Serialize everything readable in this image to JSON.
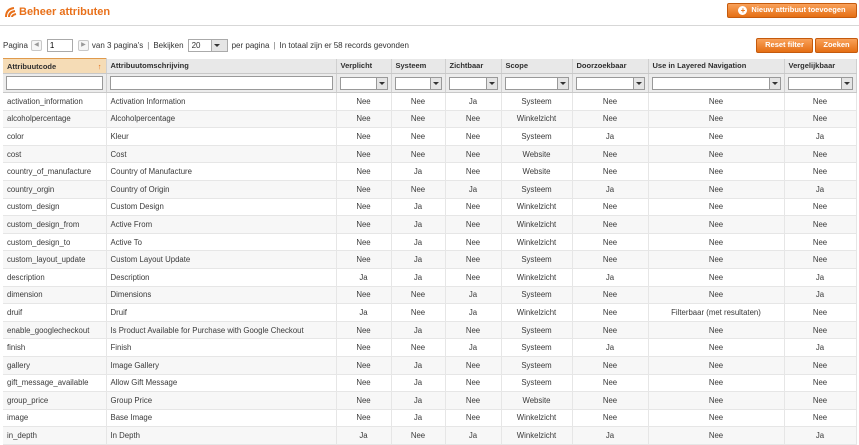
{
  "header": {
    "title": "Beheer attributen",
    "new_button": "Nieuw attribuut toevoegen"
  },
  "pager": {
    "page_label": "Pagina",
    "page_value": "1",
    "of_pages": "van 3 pagina's",
    "view_label": "Bekijken",
    "per_page_value": "20",
    "per_page_label": "per pagina",
    "total_text": "In totaal zijn er 58 records gevonden"
  },
  "buttons": {
    "reset": "Reset filter",
    "search": "Zoeken"
  },
  "columns": [
    "Attribuutcode",
    "Attribuutomschrijving",
    "Verplicht",
    "Systeem",
    "Zichtbaar",
    "Scope",
    "Doorzoekbaar",
    "Use in Layered Navigation",
    "Vergelijkbaar"
  ],
  "sort_indicator": "↑",
  "rows": [
    [
      "activation_information",
      "Activation Information",
      "Nee",
      "Nee",
      "Ja",
      "Systeem",
      "Nee",
      "Nee",
      "Nee"
    ],
    [
      "alcoholpercentage",
      "Alcoholpercentage",
      "Nee",
      "Nee",
      "Nee",
      "Winkelzicht",
      "Nee",
      "Nee",
      "Nee"
    ],
    [
      "color",
      "Kleur",
      "Nee",
      "Nee",
      "Nee",
      "Systeem",
      "Ja",
      "Nee",
      "Ja"
    ],
    [
      "cost",
      "Cost",
      "Nee",
      "Nee",
      "Nee",
      "Website",
      "Nee",
      "Nee",
      "Nee"
    ],
    [
      "country_of_manufacture",
      "Country of Manufacture",
      "Nee",
      "Ja",
      "Nee",
      "Website",
      "Nee",
      "Nee",
      "Nee"
    ],
    [
      "country_orgin",
      "Country of Origin",
      "Nee",
      "Nee",
      "Ja",
      "Systeem",
      "Ja",
      "Nee",
      "Ja"
    ],
    [
      "custom_design",
      "Custom Design",
      "Nee",
      "Ja",
      "Nee",
      "Winkelzicht",
      "Nee",
      "Nee",
      "Nee"
    ],
    [
      "custom_design_from",
      "Active From",
      "Nee",
      "Ja",
      "Nee",
      "Winkelzicht",
      "Nee",
      "Nee",
      "Nee"
    ],
    [
      "custom_design_to",
      "Active To",
      "Nee",
      "Ja",
      "Nee",
      "Winkelzicht",
      "Nee",
      "Nee",
      "Nee"
    ],
    [
      "custom_layout_update",
      "Custom Layout Update",
      "Nee",
      "Ja",
      "Nee",
      "Systeem",
      "Nee",
      "Nee",
      "Nee"
    ],
    [
      "description",
      "Description",
      "Ja",
      "Ja",
      "Nee",
      "Winkelzicht",
      "Ja",
      "Nee",
      "Ja"
    ],
    [
      "dimension",
      "Dimensions",
      "Nee",
      "Nee",
      "Ja",
      "Systeem",
      "Nee",
      "Nee",
      "Ja"
    ],
    [
      "druif",
      "Druif",
      "Ja",
      "Nee",
      "Ja",
      "Winkelzicht",
      "Nee",
      "Filterbaar (met resultaten)",
      "Nee"
    ],
    [
      "enable_googlecheckout",
      "Is Product Available for Purchase with Google Checkout",
      "Nee",
      "Ja",
      "Nee",
      "Systeem",
      "Nee",
      "Nee",
      "Nee"
    ],
    [
      "finish",
      "Finish",
      "Nee",
      "Nee",
      "Ja",
      "Systeem",
      "Ja",
      "Nee",
      "Ja"
    ],
    [
      "gallery",
      "Image Gallery",
      "Nee",
      "Ja",
      "Nee",
      "Systeem",
      "Nee",
      "Nee",
      "Nee"
    ],
    [
      "gift_message_available",
      "Allow Gift Message",
      "Nee",
      "Ja",
      "Nee",
      "Systeem",
      "Nee",
      "Nee",
      "Nee"
    ],
    [
      "group_price",
      "Group Price",
      "Nee",
      "Ja",
      "Nee",
      "Website",
      "Nee",
      "Nee",
      "Nee"
    ],
    [
      "image",
      "Base Image",
      "Nee",
      "Ja",
      "Nee",
      "Winkelzicht",
      "Nee",
      "Nee",
      "Nee"
    ],
    [
      "in_depth",
      "In Depth",
      "Ja",
      "Nee",
      "Ja",
      "Winkelzicht",
      "Ja",
      "Nee",
      "Ja"
    ]
  ]
}
